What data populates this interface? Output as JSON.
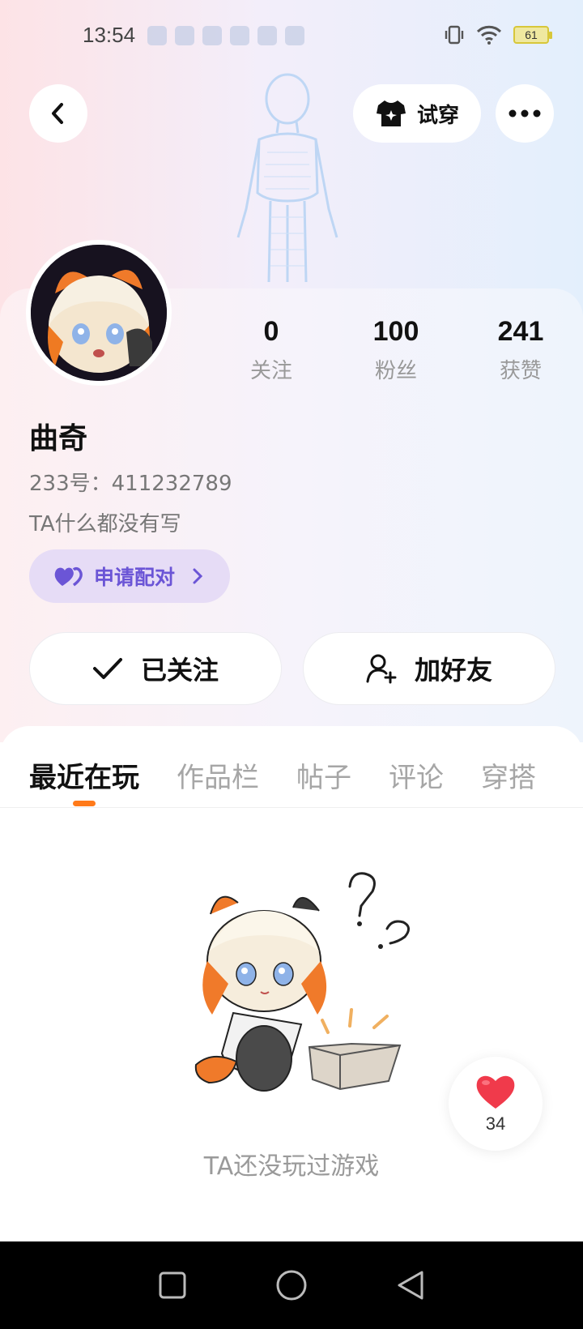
{
  "status_bar": {
    "time": "13:54",
    "battery": "61",
    "icons": [
      "vibrate-icon",
      "wifi-icon",
      "battery-icon"
    ]
  },
  "header": {
    "try_on_label": "试穿"
  },
  "profile": {
    "name": "曲奇",
    "uid": "233号：411232789",
    "bio": "TA什么都没有写",
    "pair_label": "申请配对"
  },
  "stats": [
    {
      "value": "0",
      "label": "关注"
    },
    {
      "value": "100",
      "label": "粉丝"
    },
    {
      "value": "241",
      "label": "获赞"
    }
  ],
  "actions": {
    "follow_label": "已关注",
    "add_friend_label": "加好友"
  },
  "tabs": [
    {
      "label": "最近在玩",
      "active": true
    },
    {
      "label": "作品栏",
      "active": false
    },
    {
      "label": "帖子",
      "active": false
    },
    {
      "label": "评论",
      "active": false
    },
    {
      "label": "穿搭",
      "active": false
    }
  ],
  "empty_state": {
    "text": "TA还没玩过游戏"
  },
  "like_bubble": {
    "count": "34"
  },
  "colors": {
    "accent_orange": "#ff7a1a",
    "pair_purple": "#6b55d6",
    "like_red": "#f03a4b"
  }
}
